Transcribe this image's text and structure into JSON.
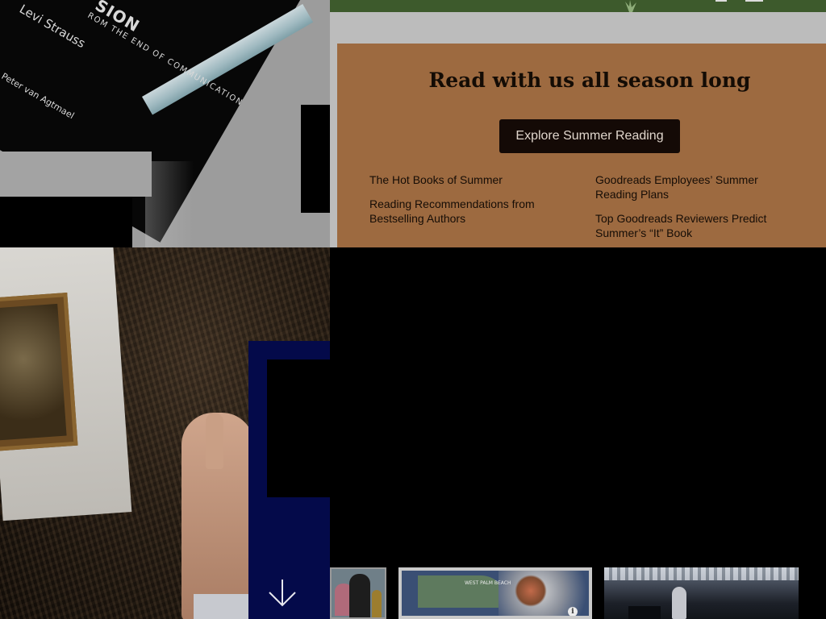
{
  "book_photo": {
    "title_fragment": "SION",
    "subtitle_fragment": "ROM THE END OF COMMUNICATION",
    "author_1": "Levi Strauss",
    "author_2": "Peter van Agtmael"
  },
  "promo": {
    "title": "Read with us all season long",
    "button_label": "Explore Summer Reading",
    "links_left": [
      "The Hot Books of Summer",
      "Reading Recommendations from Bestselling Authors"
    ],
    "links_right": [
      "Goodreads Employees’ Summer Reading Plans",
      "Top Goodreads Reviewers Predict Summer’s “It” Book"
    ]
  },
  "thumbnails": {
    "map_label": "WEST PALM BEACH",
    "map_info_glyph": "i"
  },
  "colors": {
    "promo_background": "#9d6a40",
    "button_background": "#140a06",
    "navy_panel": "#040a4a",
    "header_green": "#3d5a2c"
  },
  "icons": {
    "scroll_down": "arrow-down-icon",
    "info": "info-icon"
  }
}
